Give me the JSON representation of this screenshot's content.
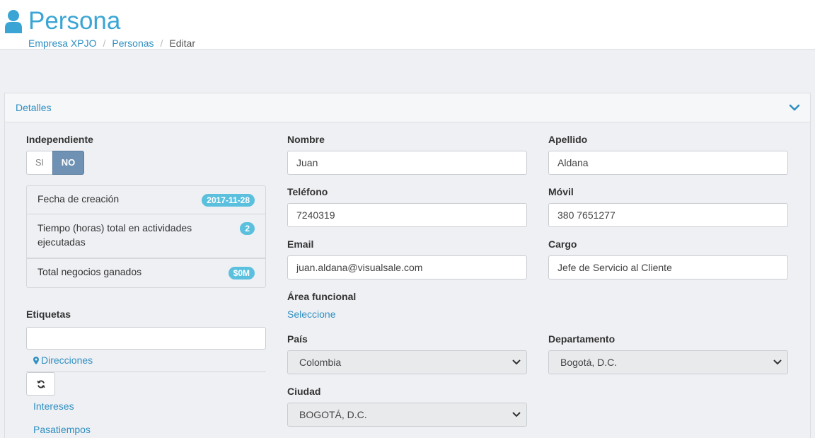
{
  "header": {
    "title": "Persona",
    "breadcrumb": [
      "Empresa XPJO",
      "Personas",
      "Editar"
    ]
  },
  "panel": {
    "title": "Detalles"
  },
  "left": {
    "independiente_label": "Independiente",
    "toggle": {
      "si": "SI",
      "no": "NO",
      "selected": "NO"
    },
    "stats": [
      {
        "label": "Fecha de creación",
        "badge": "2017-11-28"
      },
      {
        "label": "Tiempo (horas) total en actividades ejecutadas",
        "badge": "2"
      },
      {
        "label": "Total negocios ganados",
        "badge": "$0M"
      }
    ],
    "etiquetas_label": "Etiquetas",
    "etiquetas_value": "",
    "direcciones": "Direcciones",
    "intereses": "Intereses",
    "pasatiempos": "Pasatiempos"
  },
  "form": {
    "nombre": {
      "label": "Nombre",
      "value": "Juan"
    },
    "apellido": {
      "label": "Apellido",
      "value": "Aldana"
    },
    "telefono": {
      "label": "Teléfono",
      "value": "7240319"
    },
    "movil": {
      "label": "Móvil",
      "value": "380 7651277"
    },
    "email": {
      "label": "Email",
      "value": "juan.aldana@visualsale.com"
    },
    "cargo": {
      "label": "Cargo",
      "value": "Jefe de Servicio al Cliente"
    },
    "area": {
      "label": "Área funcional",
      "link": "Seleccione"
    },
    "pais": {
      "label": "País",
      "value": "Colombia"
    },
    "departamento": {
      "label": "Departamento",
      "value": "Bogotá, D.C."
    },
    "ciudad": {
      "label": "Ciudad",
      "value": "BOGOTÁ, D.C."
    }
  },
  "colors": {
    "accent": "#3aa5d4",
    "link": "#2f8fc1",
    "badge": "#5bc0de",
    "toggle_active": "#6f92b4"
  },
  "icons": [
    "user-icon",
    "chevron-down-icon",
    "map-marker-icon",
    "refresh-icon",
    "caret-down-icon"
  ]
}
